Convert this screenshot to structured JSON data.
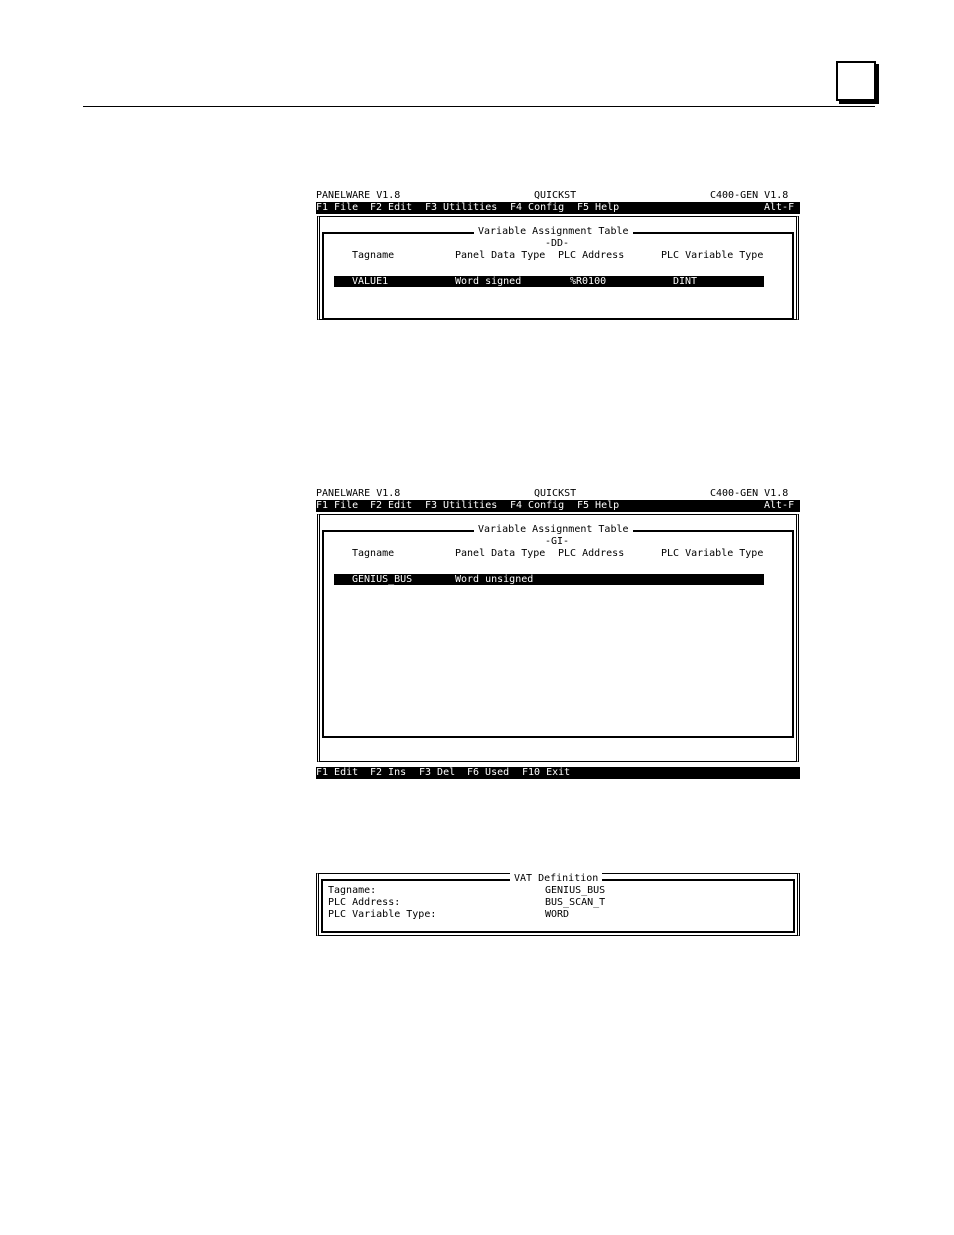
{
  "page": {
    "tab_marker": ""
  },
  "screen1": {
    "title_left": "PANELWARE V1.8",
    "title_center": "QUICKST",
    "title_right": "C400-GEN V1.8",
    "menu": [
      "F1 File",
      "F2 Edit",
      "F3 Utilities",
      "F4 Config",
      "F5 Help"
    ],
    "menu_right": "Alt-F",
    "table_title": "Variable Assignment Table",
    "table_subtitle": "-DD-",
    "headers": [
      "Tagname",
      "Panel Data Type",
      "PLC Address",
      "PLC Variable Type"
    ],
    "rows": [
      {
        "tagname": "VALUE1",
        "panel_data_type": "Word signed",
        "plc_address": "%R0100",
        "plc_variable_type": "DINT"
      }
    ]
  },
  "screen2": {
    "title_left": "PANELWARE V1.8",
    "title_center": "QUICKST",
    "title_right": "C400-GEN V1.8",
    "menu": [
      "F1 File",
      "F2 Edit",
      "F3 Utilities",
      "F4 Config",
      "F5 Help"
    ],
    "menu_right": "Alt-F",
    "table_title": "Variable Assignment Table",
    "table_subtitle": "-GI-",
    "headers": [
      "Tagname",
      "Panel Data Type",
      "PLC Address",
      "PLC Variable Type"
    ],
    "rows": [
      {
        "tagname": "GENIUS_BUS",
        "panel_data_type": "Word unsigned",
        "plc_address": "",
        "plc_variable_type": ""
      }
    ],
    "fkeys": [
      "F1 Edit",
      "F2 Ins",
      "F3 Del",
      "F6 Used",
      "F10 Exit"
    ]
  },
  "vat_definition": {
    "title": "VAT Definition",
    "fields": [
      {
        "label": "Tagname:",
        "value": "GENIUS_BUS"
      },
      {
        "label": "PLC Address:",
        "value": "BUS_SCAN_T"
      },
      {
        "label": "PLC Variable Type:",
        "value": "WORD"
      }
    ]
  }
}
